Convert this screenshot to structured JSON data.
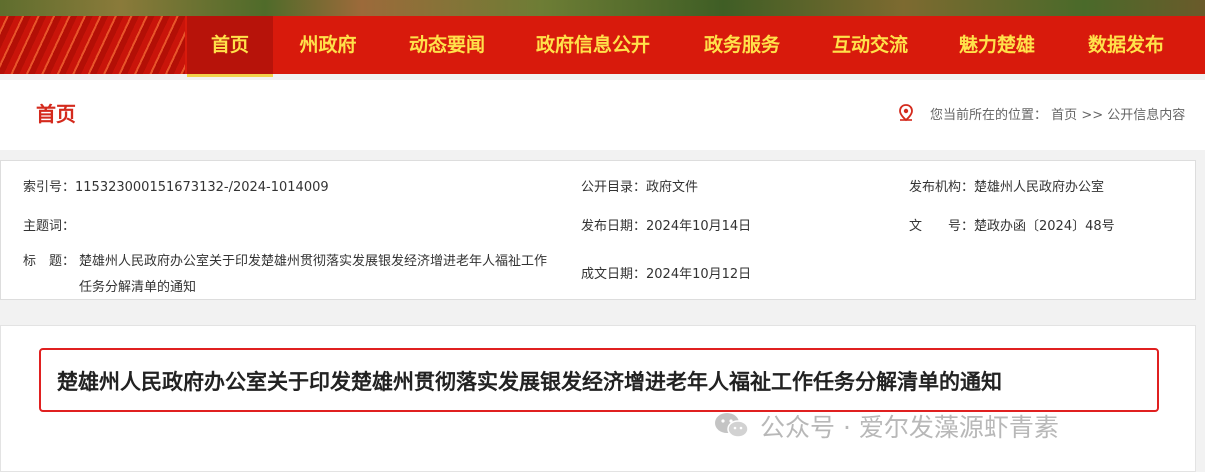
{
  "nav": {
    "items": [
      {
        "label": "首页",
        "active": true
      },
      {
        "label": "州政府",
        "active": false
      },
      {
        "label": "动态要闻",
        "active": false
      },
      {
        "label": "政府信息公开",
        "active": false
      },
      {
        "label": "政务服务",
        "active": false
      },
      {
        "label": "互动交流",
        "active": false
      },
      {
        "label": "魅力楚雄",
        "active": false
      },
      {
        "label": "数据发布",
        "active": false
      }
    ]
  },
  "location": {
    "page_title": "首页",
    "prefix": "您当前所在的位置：",
    "crumb_home": "首页",
    "separator": ">>",
    "crumb_current": "公开信息内容"
  },
  "meta": {
    "index_label": "索引号：",
    "index_value": "115323000151673132-/2024-1014009",
    "category_label": "公开目录：",
    "category_value": "政府文件",
    "publisher_label": "发布机构：",
    "publisher_value": "楚雄州人民政府办公室",
    "subject_label": "主题词：",
    "subject_value": "",
    "publish_date_label": "发布日期：",
    "publish_date_value": "2024年10月14日",
    "doc_no_label": "文　　号：",
    "doc_no_value": "楚政办函〔2024〕48号",
    "title_label": "标　题：",
    "title_value": "楚雄州人民政府办公室关于印发楚雄州贯彻落实发展银发经济增进老年人福祉工作任务分解清单的通知",
    "created_date_label": "成文日期：",
    "created_date_value": "2024年10月12日"
  },
  "document": {
    "title": "楚雄州人民政府办公室关于印发楚雄州贯彻落实发展银发经济增进老年人福祉工作任务分解清单的通知"
  },
  "watermark": {
    "text": "公众号 · 爱尔发藻源虾青素"
  },
  "colors": {
    "nav_bg": "#d81a0c",
    "nav_text": "#ffe14a",
    "title_red": "#d42a1d",
    "highlight_frame": "#e02020"
  }
}
